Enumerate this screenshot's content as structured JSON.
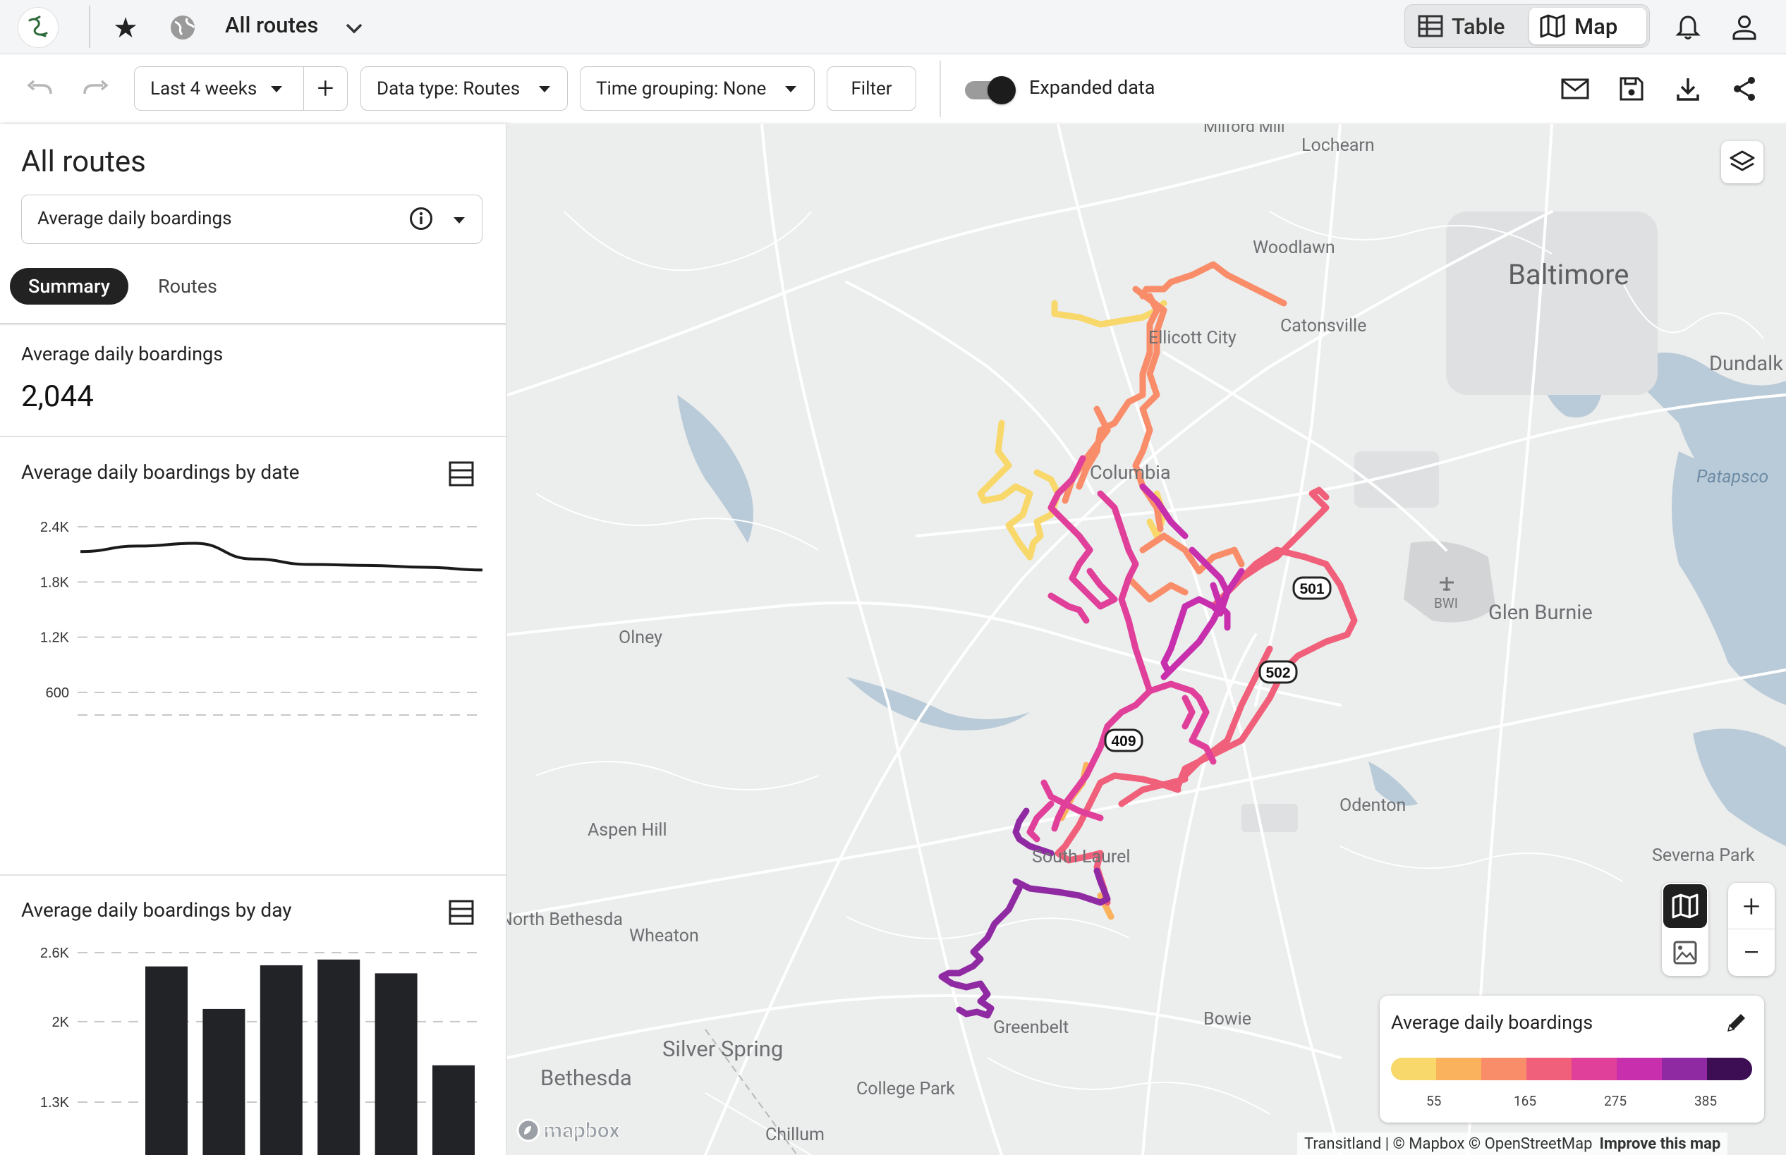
{
  "app": {
    "title": "All routes",
    "view_toggle": {
      "table_label": "Table",
      "map_label": "Map",
      "active": "Map"
    }
  },
  "toolbar": {
    "date_range": "Last 4 weeks",
    "data_type": "Data type: Routes",
    "time_grouping": "Time grouping: None",
    "filter_label": "Filter",
    "expanded_label": "Expanded data",
    "expanded_on": true
  },
  "sidebar": {
    "title": "All routes",
    "metric_select": "Average daily boardings",
    "tabs": [
      {
        "label": "Summary",
        "active": true
      },
      {
        "label": "Routes",
        "active": false
      }
    ],
    "summary": {
      "label": "Average daily boardings",
      "value": "2,044"
    },
    "date_chart_title": "Average daily boardings by date",
    "day_chart_title": "Average daily boardings by day"
  },
  "chart_data": [
    {
      "type": "line",
      "title": "Average daily boardings by date",
      "ytick_labels": [
        "2.4K",
        "1.8K",
        "1.2K",
        "600"
      ],
      "ylim": [
        0,
        2400
      ],
      "x": [
        0,
        1,
        2,
        3,
        4,
        5,
        6,
        7
      ],
      "values": [
        2130,
        2190,
        2220,
        2050,
        1990,
        1980,
        1960,
        1930
      ],
      "grid": true
    },
    {
      "type": "bar",
      "title": "Average daily boardings by day",
      "ytick_labels": [
        "2.6K",
        "2K",
        "1.3K"
      ],
      "ylim": [
        0,
        2600
      ],
      "values": [
        2480,
        2110,
        2490,
        2540,
        2420,
        1620
      ],
      "grid": true
    }
  ],
  "map": {
    "places": [
      {
        "name": "Milford Mill"
      },
      {
        "name": "Lochearn"
      },
      {
        "name": "Woodlawn"
      },
      {
        "name": "Baltimore"
      },
      {
        "name": "Catonsville"
      },
      {
        "name": "Ellicott City"
      },
      {
        "name": "Dundalk"
      },
      {
        "name": "Patapsco"
      },
      {
        "name": "Columbia"
      },
      {
        "name": "BWI"
      },
      {
        "name": "Glen Burnie"
      },
      {
        "name": "Olney"
      },
      {
        "name": "Odenton"
      },
      {
        "name": "Aspen Hill"
      },
      {
        "name": "South Laurel"
      },
      {
        "name": "Severna Park"
      },
      {
        "name": "North Bethesda"
      },
      {
        "name": "Wheaton"
      },
      {
        "name": "Bowie"
      },
      {
        "name": "Greenbelt"
      },
      {
        "name": "Silver Spring"
      },
      {
        "name": "Bethesda"
      },
      {
        "name": "College Park"
      },
      {
        "name": "Chillum"
      }
    ],
    "shields": [
      "501",
      "502",
      "409"
    ],
    "legend": {
      "title": "Average daily boardings",
      "colors": [
        "#f9d86b",
        "#fbb25c",
        "#f98d6a",
        "#f0607a",
        "#e0409a",
        "#c82fad",
        "#8f2aa3",
        "#3e0e55"
      ],
      "tick_labels": [
        "55",
        "165",
        "275",
        "385"
      ]
    },
    "attribution": {
      "text": "Transitland | © Mapbox © OpenStreetMap",
      "improve": "Improve this map"
    },
    "brand": "mapbox"
  }
}
